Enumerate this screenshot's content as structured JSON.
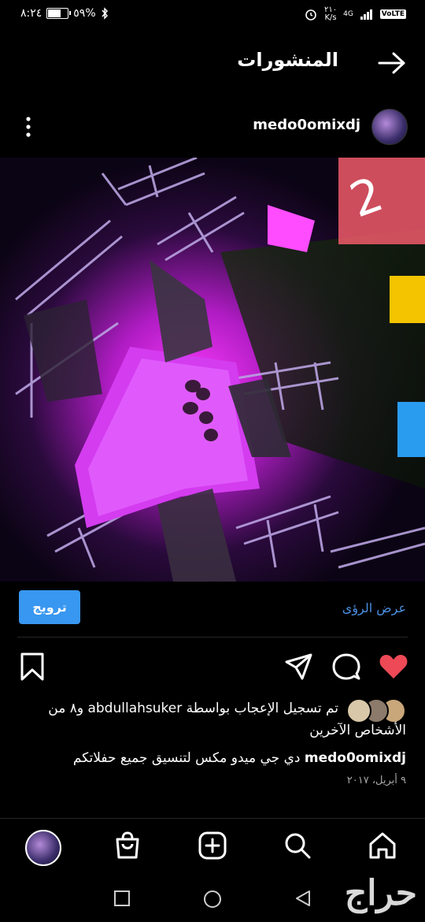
{
  "status_bar": {
    "time": "٨:٢٤",
    "battery": "٥٩%",
    "network_speed_value": "٢١٠",
    "network_speed_unit": "K/s",
    "network_type": "4G",
    "volte": "VoLTE"
  },
  "header": {
    "title": "المنشورات"
  },
  "post": {
    "username": "medo0omixdj",
    "insights_label": "عرض الرؤى",
    "promote_label": "ترويج",
    "likes_text_line1": "تم تسجيل الإعجاب بواسطة abdullahsuker و٨ من",
    "likes_text_line2": "الأشخاص الآخرين",
    "caption_username": "medo0omixdj",
    "caption_text": "دي جي ميدو مكس لتنسيق جميع حفلاتكم",
    "date": "٩ أبريل، ٢٠١٧",
    "liked": true
  },
  "colors": {
    "background": "#000000",
    "accent_blue": "#3897f0",
    "link_blue": "#4a90e2",
    "heart_red": "#ed4956",
    "muted": "#a8a8a8"
  },
  "watermark": "حراج",
  "icons": [
    "back-arrow-icon",
    "more-vertical-icon",
    "heart-icon",
    "comment-icon",
    "share-icon",
    "bookmark-icon",
    "home-icon",
    "search-icon",
    "add-icon",
    "shop-icon",
    "square-icon",
    "circle-icon",
    "triangle-back-icon",
    "alarm-icon",
    "bluetooth-icon",
    "signal-icon"
  ]
}
